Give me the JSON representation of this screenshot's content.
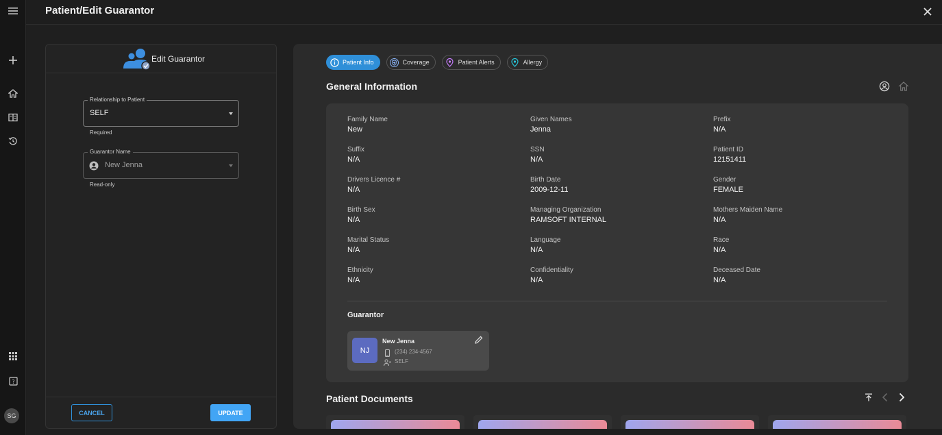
{
  "window": {
    "title": "Patient/Edit Guarantor"
  },
  "rail": {
    "avatar_initials": "SG"
  },
  "edit_guarantor": {
    "heading": "Edit Guarantor",
    "relationship": {
      "label": "Relationship to Patient",
      "value": "SELF",
      "helper": "Required"
    },
    "guarantor_name": {
      "label": "Guarantor Name",
      "value": "New Jenna",
      "helper": "Read-only"
    },
    "cancel_label": "CANCEL",
    "update_label": "UPDATE"
  },
  "tabs": [
    {
      "label": "Patient Info",
      "active": true,
      "icon": "info-icon"
    },
    {
      "label": "Coverage",
      "active": false,
      "icon": "shield-icon"
    },
    {
      "label": "Patient Alerts",
      "active": false,
      "icon": "alert-pin-icon"
    },
    {
      "label": "Allergy",
      "active": false,
      "icon": "allergy-pin-icon"
    }
  ],
  "general_info": {
    "title": "General Information",
    "fields": [
      {
        "label": "Family Name",
        "value": "New"
      },
      {
        "label": "Given Names",
        "value": "Jenna"
      },
      {
        "label": "Prefix",
        "value": "N/A"
      },
      {
        "label": "Suffix",
        "value": "N/A"
      },
      {
        "label": "SSN",
        "value": "N/A"
      },
      {
        "label": "Patient ID",
        "value": "12151411"
      },
      {
        "label": "Drivers Licence #",
        "value": "N/A"
      },
      {
        "label": "Birth Date",
        "value": "2009-12-11"
      },
      {
        "label": "Gender",
        "value": "FEMALE"
      },
      {
        "label": "Birth Sex",
        "value": "N/A"
      },
      {
        "label": "Managing Organization",
        "value": "RAMSOFT INTERNAL"
      },
      {
        "label": "Mothers Maiden Name",
        "value": "N/A"
      },
      {
        "label": "Marital Status",
        "value": "N/A"
      },
      {
        "label": "Language",
        "value": "N/A"
      },
      {
        "label": "Race",
        "value": "N/A"
      },
      {
        "label": "Ethnicity",
        "value": "N/A"
      },
      {
        "label": "Confidentiality",
        "value": "N/A"
      },
      {
        "label": "Deceased Date",
        "value": "N/A"
      }
    ]
  },
  "guarantor": {
    "title": "Guarantor",
    "initials": "NJ",
    "name": "New Jenna",
    "phone": "(234) 234-4567",
    "relationship": "SELF"
  },
  "patient_documents": {
    "title": "Patient Documents"
  },
  "colors": {
    "accent": "#42a5f5",
    "avatar": "#5c6bc0"
  }
}
